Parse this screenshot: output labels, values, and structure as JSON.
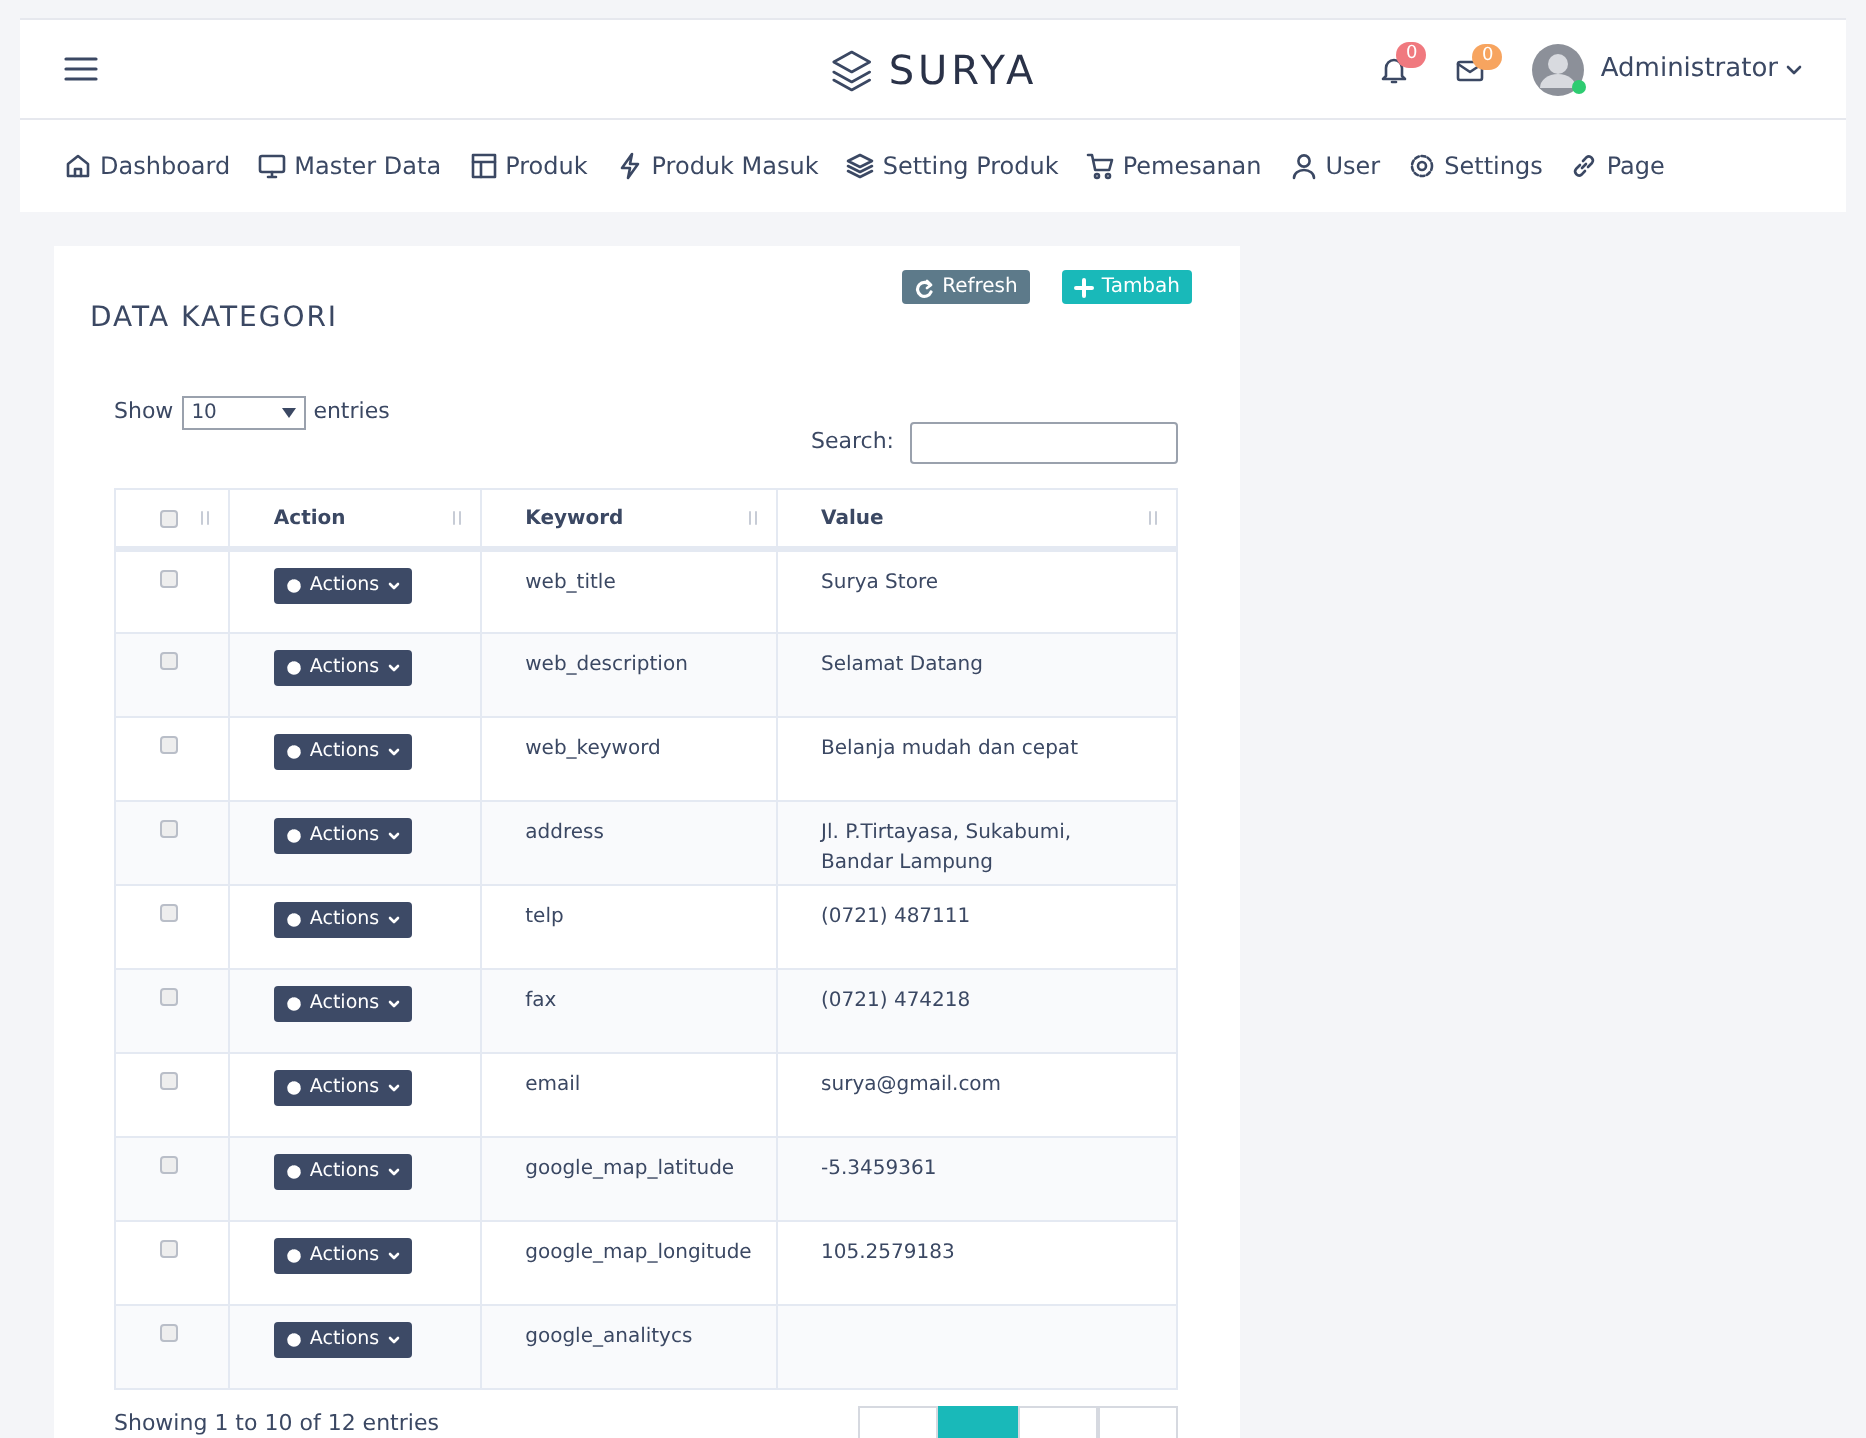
{
  "topbar": {
    "brand": "SURYA",
    "notifications": {
      "count": "0"
    },
    "messages": {
      "count": "0"
    },
    "user": {
      "name": "Administrator"
    }
  },
  "menu": [
    {
      "label": "Dashboard"
    },
    {
      "label": "Master Data"
    },
    {
      "label": "Produk"
    },
    {
      "label": "Produk Masuk"
    },
    {
      "label": "Setting Produk"
    },
    {
      "label": "Pemesanan"
    },
    {
      "label": "User"
    },
    {
      "label": "Settings"
    },
    {
      "label": "Page"
    }
  ],
  "panel": {
    "title": "DATA KATEGORI",
    "buttons": [
      {
        "label": "Refresh",
        "kind": "refresh"
      },
      {
        "label": "Tambah",
        "kind": "add"
      }
    ],
    "length": {
      "before": "Show",
      "value": "10",
      "after": "entries"
    },
    "search": {
      "label": "Search:"
    },
    "table": {
      "select_all_checked": false,
      "columns": [
        "Action",
        "Keyword",
        "Value"
      ],
      "rows": [
        {
          "checked": false,
          "action": "Actions",
          "keyword": "web_title",
          "value": "Surya Store"
        },
        {
          "checked": false,
          "action": "Actions",
          "keyword": "web_description",
          "value": "Selamat Datang"
        },
        {
          "checked": false,
          "action": "Actions",
          "keyword": "web_keyword",
          "value": "Belanja mudah dan cepat"
        },
        {
          "checked": false,
          "action": "Actions",
          "keyword": "address",
          "value": "Jl. P.Tirtayasa, Sukabumi, Bandar Lampung"
        },
        {
          "checked": false,
          "action": "Actions",
          "keyword": "telp",
          "value": "(0721) 487111"
        },
        {
          "checked": false,
          "action": "Actions",
          "keyword": "fax",
          "value": "(0721) 474218"
        },
        {
          "checked": false,
          "action": "Actions",
          "keyword": "email",
          "value": "surya@gmail.com"
        },
        {
          "checked": false,
          "action": "Actions",
          "keyword": "google_map_latitude",
          "value": "-5.3459361"
        },
        {
          "checked": false,
          "action": "Actions",
          "keyword": "google_map_longitude",
          "value": "105.2579183"
        },
        {
          "checked": false,
          "action": "Actions",
          "keyword": "google_analitycs",
          "value": ""
        }
      ]
    },
    "info": "Showing 1 to 10 of 12 entries",
    "pagination": [
      {
        "selected": false
      },
      {
        "selected": true
      },
      {
        "selected": false
      },
      {
        "selected": false
      }
    ]
  }
}
